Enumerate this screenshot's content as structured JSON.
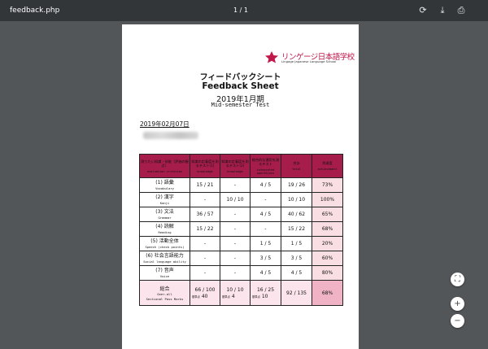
{
  "toolbar": {
    "file_name": "feedback.php",
    "page_indicator": "1 / 1",
    "rotate_icon": "rotate-icon",
    "download_icon": "download-icon",
    "print_icon": "print-icon"
  },
  "colors": {
    "toolbar": "#323639",
    "viewer_bg": "#525659",
    "header": "#a61d4c",
    "achievement": "#f9dfe4",
    "total_achievement": "#efb3c5"
  },
  "logo": {
    "jp": "リンゲージ日本語学校",
    "en": "Lingage Japanese Language School"
  },
  "sheet": {
    "title_jp": "フィードバックシート",
    "title_en": "Feedback Sheet",
    "period": "2019年1月期",
    "subtitle": "Mid-semester Test",
    "date": "2019年02月07日",
    "table": {
      "headers": [
        {
          "jp": "測りたい知識・技能（評価の観点）",
          "en": "evaluation criterion"
        },
        {
          "jp": "知識の定着度を測るテスト(1)",
          "en": "knowledge"
        },
        {
          "jp": "知識の定着度を測るテスト(2)",
          "en": "knowledge"
        },
        {
          "jp": "総合的な運用を測るテスト",
          "en": "integrated operations"
        },
        {
          "jp": "合計",
          "en": "total"
        },
        {
          "jp": "到達度",
          "en": "achievement"
        }
      ],
      "rows": [
        {
          "jp": "(1) 語彙",
          "en": "Vocabulary",
          "t1": "15 / 21",
          "t2": "-",
          "t3": "4 / 5",
          "total": "19 / 26",
          "ach": "73%"
        },
        {
          "jp": "(2) 漢字",
          "en": "Kanji",
          "t1": "-",
          "t2": "10 / 10",
          "t3": "-",
          "total": "10 / 10",
          "ach": "100%"
        },
        {
          "jp": "(3) 文法",
          "en": "Grammar",
          "t1": "36 / 57",
          "t2": "-",
          "t3": "4 / 5",
          "total": "40 / 62",
          "ach": "65%"
        },
        {
          "jp": "(4) 読解",
          "en": "Reading",
          "t1": "15 / 22",
          "t2": "-",
          "t3": "-",
          "total": "15 / 22",
          "ach": "68%"
        },
        {
          "jp": "(5) 活動全体",
          "en": "Speech (check points)",
          "t1": "-",
          "t2": "-",
          "t3": "1 / 5",
          "total": "1 / 5",
          "ach": "20%"
        },
        {
          "jp": "(6) 社会言語能力",
          "en": "Social language ability",
          "t1": "-",
          "t2": "-",
          "t3": "3 / 5",
          "total": "3 / 5",
          "ach": "60%"
        },
        {
          "jp": "(7) 音声",
          "en": "Voice",
          "t1": "-",
          "t2": "-",
          "t3": "4 / 5",
          "total": "4 / 5",
          "ach": "80%"
        }
      ],
      "total": {
        "jp": "総合",
        "en1": "Over-all",
        "en2": "Sectional Pass Marks",
        "t1": "66 / 100",
        "t2": "10 / 10",
        "t3": "16 / 25",
        "total": "92 / 135",
        "ach": "68%",
        "pass_label": "基準点",
        "pass1": "40",
        "pass2": "4",
        "pass3": "10"
      }
    }
  },
  "controls": {
    "fit_icon": "fit-page-icon",
    "zoom_in_icon": "zoom-in-icon",
    "zoom_out_icon": "zoom-out-icon"
  }
}
